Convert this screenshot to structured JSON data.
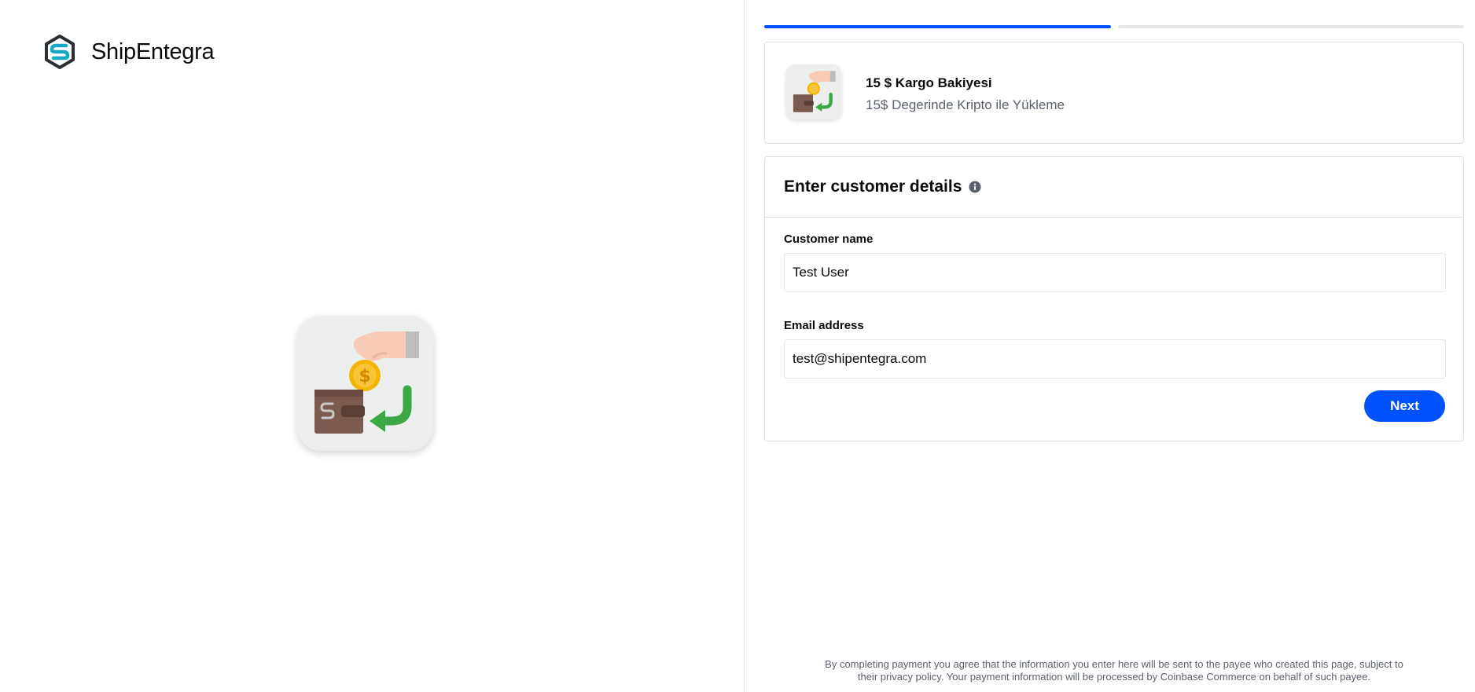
{
  "brand": {
    "name": "ShipEntegra",
    "logo_icon": "shipentegra-logo-icon"
  },
  "hero": {
    "icon": "wallet-coin-transfer-icon"
  },
  "progress": {
    "steps": 2,
    "current": 1
  },
  "product": {
    "title": "15 $ Kargo Bakiyesi",
    "description": "15$ Degerinde Kripto ile Yükleme"
  },
  "customer_form": {
    "title": "Enter customer details",
    "info_icon": "info-icon",
    "name_label": "Customer name",
    "name_value": "Test User",
    "email_label": "Email address",
    "email_value": "test@shipentegra.com",
    "next_label": "Next"
  },
  "footer": {
    "line1": "By completing payment you agree that the information you enter here will be sent to the payee who created this page, subject to",
    "line2": "their privacy policy. Your payment information will be processed by Coinbase Commerce on behalf of such payee."
  },
  "colors": {
    "accent": "#0052ff",
    "text": "#0a0b0d",
    "muted": "#5b616e",
    "border": "#dfe1e5"
  }
}
